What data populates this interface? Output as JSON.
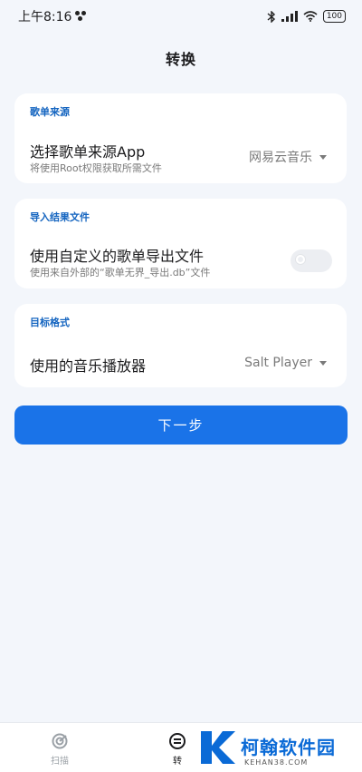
{
  "status_bar": {
    "time": "上午8:16",
    "battery": "100"
  },
  "page": {
    "title": "转换"
  },
  "source_card": {
    "header": "歌单来源",
    "title": "选择歌单来源App",
    "subtitle": "将使用Root权限获取所需文件",
    "selected_value": "网易云音乐"
  },
  "import_card": {
    "header": "导入结果文件",
    "title": "使用自定义的歌单导出文件",
    "subtitle": "使用来自外部的“歌单无界_导出.db”文件",
    "toggle_on": false
  },
  "target_card": {
    "header": "目标格式",
    "title": "使用的音乐播放器",
    "selected_value": "Salt Player"
  },
  "next_button": {
    "label": "下一步"
  },
  "bottom_nav": {
    "items": [
      {
        "label": "扫描",
        "icon": "scan-icon"
      },
      {
        "label": "转",
        "icon": "convert-icon"
      }
    ]
  },
  "watermark": {
    "title": "柯翰软件园",
    "subtitle": "KEHAN38.COM",
    "accent": "#0a6ad6"
  },
  "colors": {
    "accent": "#1a73e8",
    "background": "#f3f6fb",
    "header_text": "#1565c0"
  }
}
